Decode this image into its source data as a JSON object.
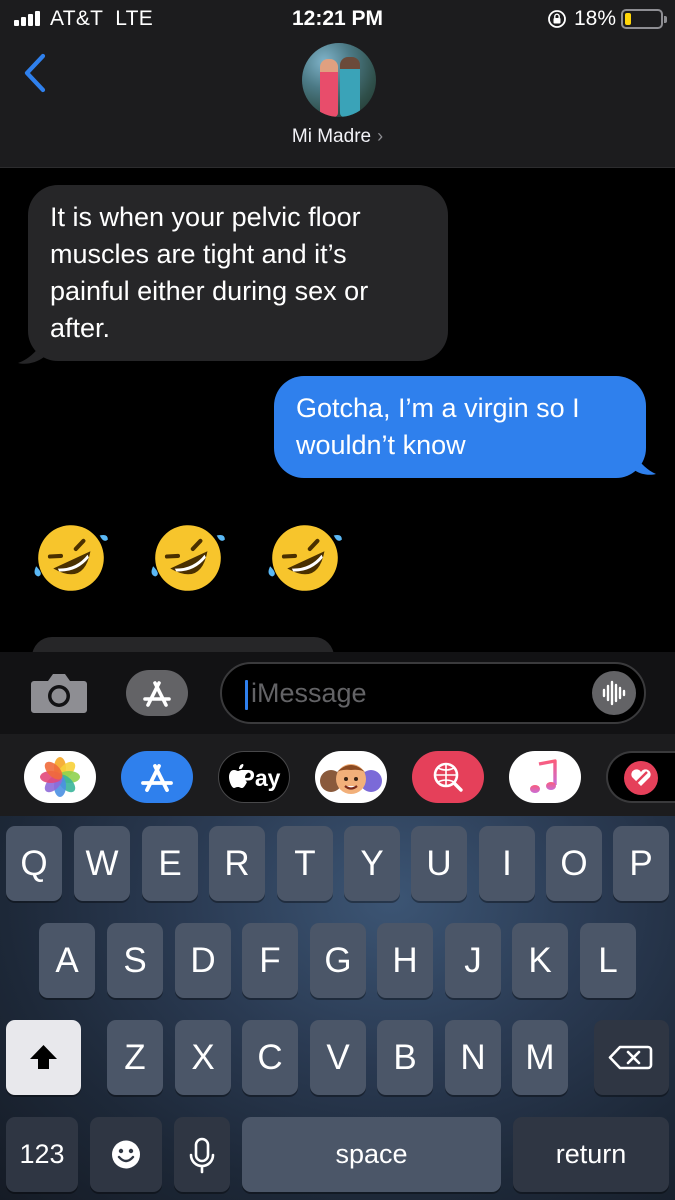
{
  "status_bar": {
    "carrier": "AT&T  LTE",
    "time": "12:21 PM",
    "battery_percent": "18%",
    "battery_level": 0.18
  },
  "header": {
    "contact_name": "Mi Madre"
  },
  "messages": [
    {
      "direction": "incoming",
      "lines": [
        "It is when your pelvic floor",
        "muscles are tight and it’s",
        "painful either during sex or",
        "after."
      ]
    },
    {
      "direction": "outgoing",
      "lines": [
        "Gotcha, I’m a virgin so I",
        "wouldn’t know"
      ]
    },
    {
      "direction": "incoming",
      "emoji": "🤣🤣🤣",
      "emoji_name": "rolling-on-the-floor-laughing",
      "count": 3
    }
  ],
  "input": {
    "placeholder": "iMessage",
    "value": ""
  },
  "app_drawer": [
    {
      "name": "photos",
      "icon": "photos-icon",
      "label": ""
    },
    {
      "name": "app-store",
      "icon": "app-store-icon",
      "label": ""
    },
    {
      "name": "apple-pay",
      "icon": "apple-icon",
      "label": "Pay"
    },
    {
      "name": "memoji",
      "icon": "memoji-icon",
      "label": ""
    },
    {
      "name": "web-search",
      "icon": "globe-search-icon",
      "label": ""
    },
    {
      "name": "music",
      "icon": "music-note-icon",
      "label": ""
    },
    {
      "name": "digital-touch",
      "icon": "heart-icon",
      "label": ""
    }
  ],
  "keyboard": {
    "row1": [
      "Q",
      "W",
      "E",
      "R",
      "T",
      "Y",
      "U",
      "I",
      "O",
      "P"
    ],
    "row2": [
      "A",
      "S",
      "D",
      "F",
      "G",
      "H",
      "J",
      "K",
      "L"
    ],
    "row3": [
      "Z",
      "X",
      "C",
      "V",
      "B",
      "N",
      "M"
    ],
    "numbers_label": "123",
    "space_label": "space",
    "return_label": "return"
  },
  "colors": {
    "accent": "#2f80ed",
    "incoming_bubble": "#262628",
    "battery_low": "#ffd60a"
  }
}
